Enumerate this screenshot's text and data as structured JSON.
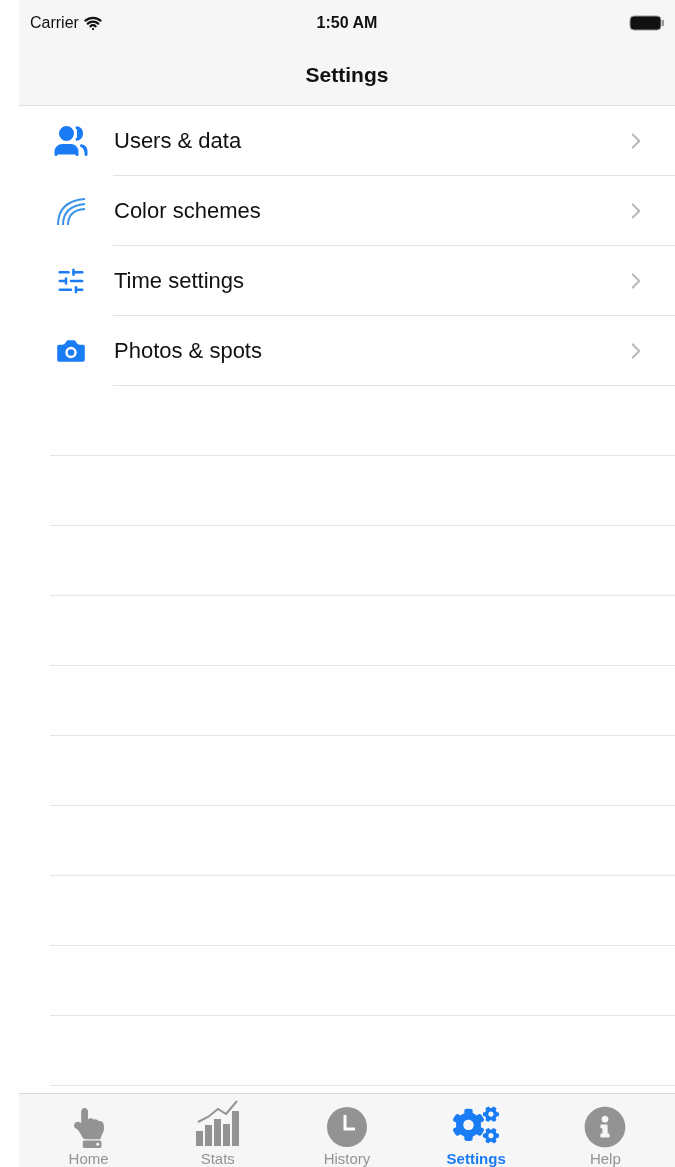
{
  "status_bar": {
    "carrier": "Carrier",
    "time": "1:50 AM"
  },
  "nav_bar": {
    "title": "Settings"
  },
  "menu": [
    {
      "kind": "users",
      "label": "Users & data"
    },
    {
      "kind": "colors",
      "label": "Color schemes"
    },
    {
      "kind": "sliders",
      "label": "Time settings"
    },
    {
      "kind": "camera",
      "label": "Photos & spots"
    }
  ],
  "tabs": [
    {
      "kind": "hand",
      "label": "Home",
      "selected": false
    },
    {
      "kind": "chart",
      "label": "Stats",
      "selected": false
    },
    {
      "kind": "clock",
      "label": "History",
      "selected": false
    },
    {
      "kind": "gears",
      "label": "Settings",
      "selected": true
    },
    {
      "kind": "info",
      "label": "Help",
      "selected": false
    }
  ]
}
